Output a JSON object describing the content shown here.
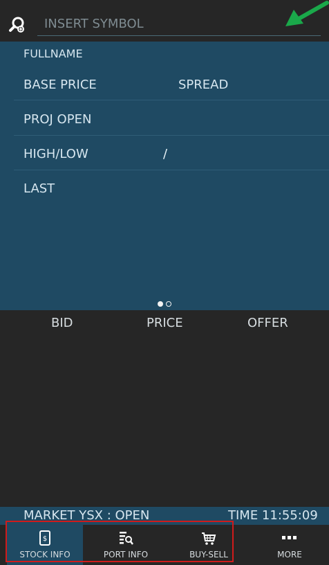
{
  "search": {
    "placeholder": "INSERT SYMBOL",
    "icon": "search-icon"
  },
  "info": {
    "fullname_label": "FULLNAME",
    "base_price_label": "BASE PRICE",
    "spread_label": "SPREAD",
    "proj_open_label": "PROJ OPEN",
    "high_low_label": "HIGH/LOW",
    "high_low_separator": "/",
    "last_label": "LAST"
  },
  "book": {
    "bid_label": "BID",
    "price_label": "PRICE",
    "offer_label": "OFFER"
  },
  "status": {
    "market": "MARKET YSX : OPEN",
    "time": "TIME 11:55:09"
  },
  "nav": {
    "items": [
      {
        "label": "STOCK INFO",
        "icon": "stock-info-icon",
        "active": true
      },
      {
        "label": "PORT INFO",
        "icon": "port-info-icon",
        "active": false
      },
      {
        "label": "BUY-SELL",
        "icon": "cart-icon",
        "active": false
      },
      {
        "label": "MORE",
        "icon": "more-icon",
        "active": false
      }
    ]
  },
  "colors": {
    "panel": "#1f4a63",
    "dark_bg": "#262626",
    "annotation_green": "#1aa84a",
    "annotation_red": "#d11b1b"
  }
}
